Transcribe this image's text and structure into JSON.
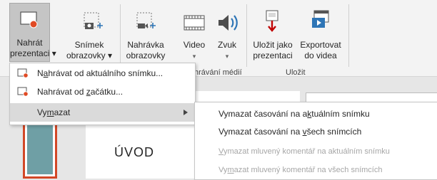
{
  "ribbon": {
    "buttons": [
      {
        "id": "record",
        "line1": "Nahrát",
        "line2": "prezentaci ▾"
      },
      {
        "id": "screenshot",
        "line1": "Snímek",
        "line2": "obrazovky ▾"
      },
      {
        "id": "screenrec",
        "line1": "Nahrávka",
        "line2": "obrazovky"
      },
      {
        "id": "video",
        "line1": "Video",
        "line2": "▾"
      },
      {
        "id": "audio",
        "line1": "Zvuk",
        "line2": "▾"
      },
      {
        "id": "saveas",
        "line1": "Uložit jako",
        "line2": "prezentaci"
      },
      {
        "id": "export",
        "line1": "Exportovat",
        "line2": "do videa"
      }
    ],
    "groups": {
      "media": "hrávání médií",
      "save": "Uložit"
    }
  },
  "menu": {
    "items": [
      {
        "pre": "N",
        "u": "a",
        "post": "hrávat od aktuálního snímku..."
      },
      {
        "pre": "Nahrávat od ",
        "u": "z",
        "post": "ačátku..."
      },
      {
        "pre": "Vy",
        "u": "m",
        "post": "azat"
      }
    ]
  },
  "submenu": {
    "items": [
      {
        "pre": "Vymazat časování na a",
        "u": "k",
        "post": "tuálním snímku"
      },
      {
        "pre": "Vymazat časování na ",
        "u": "v",
        "post": "šech snímcích"
      },
      {
        "pre": "",
        "u": "V",
        "post": "ymazat mluvený komentář na aktuálním snímku"
      },
      {
        "pre": "Vy",
        "u": "m",
        "post": "azat mluvený komentář na všech snímcích"
      }
    ]
  },
  "slide": {
    "title": "ÚVOD"
  },
  "colors": {
    "accent": "#d24726",
    "record_dot": "#e04a24",
    "thumb": "#6f9fa5"
  }
}
